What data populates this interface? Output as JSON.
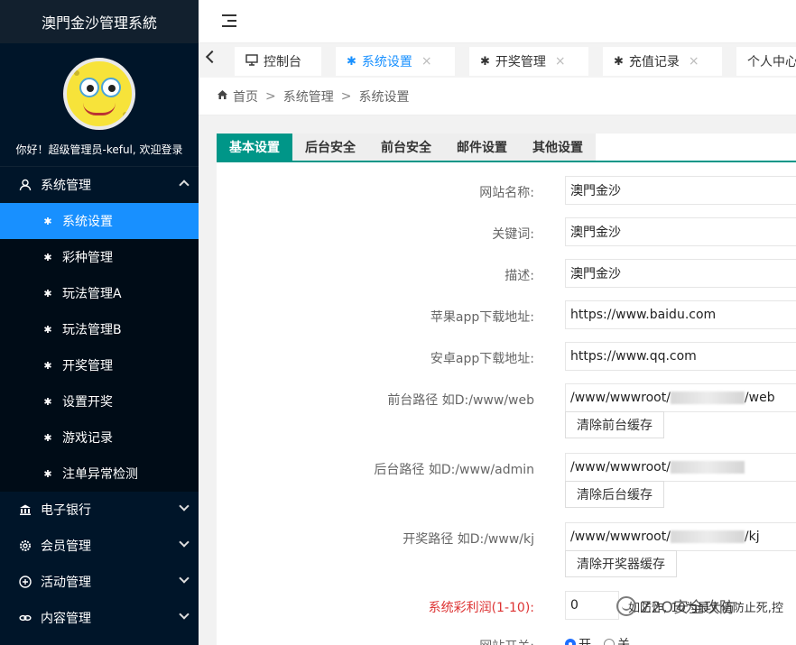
{
  "brand": {
    "title": "澳門金沙管理系統"
  },
  "user": {
    "welcome": "你好！超级管理员-keful, 欢迎登录"
  },
  "sidebar": {
    "groups": [
      {
        "label": "系统管理",
        "icon": "user-icon",
        "expanded": true
      },
      {
        "label": "电子银行",
        "icon": "bank-icon"
      },
      {
        "label": "会员管理",
        "icon": "gear-icon"
      },
      {
        "label": "活动管理",
        "icon": "plus-circle-icon"
      },
      {
        "label": "内容管理",
        "icon": "link-icon"
      }
    ],
    "items": [
      {
        "label": "系统设置",
        "active": true
      },
      {
        "label": "彩种管理"
      },
      {
        "label": "玩法管理A"
      },
      {
        "label": "玩法管理B"
      },
      {
        "label": "开奖管理"
      },
      {
        "label": "设置开奖"
      },
      {
        "label": "游戏记录"
      },
      {
        "label": "注单异常检测"
      }
    ]
  },
  "tabs": [
    {
      "label": "控制台",
      "icon": "monitor-icon"
    },
    {
      "label": "系统设置",
      "icon": "palm-icon",
      "active": true,
      "close": "×"
    },
    {
      "label": "开奖管理",
      "icon": "palm-icon",
      "close": "×"
    },
    {
      "label": "充值记录",
      "icon": "palm-icon",
      "close": "×"
    },
    {
      "label": "个人中心"
    }
  ],
  "breadcrumb": {
    "home": "首页",
    "sep": ">",
    "level1": "系统管理",
    "level2": "系统设置"
  },
  "subtabs": [
    "基本设置",
    "后台安全",
    "前台安全",
    "邮件设置",
    "其他设置"
  ],
  "form": {
    "site_name_label": "网站名称:",
    "site_name": "澳門金沙",
    "keywords_label": "关键词:",
    "keywords": "澳門金沙",
    "description_label": "描述:",
    "description": "澳門金沙",
    "ios_label": "苹果app下载地址:",
    "ios_url": "https://www.baidu.com",
    "android_label": "安卓app下载地址:",
    "android_url": "https://www.qq.com",
    "front_label": "前台路径 如D:/www/web",
    "front_prefix": "/www/wwwroot/",
    "front_suffix": "/web",
    "front_btn": "清除前台缓存",
    "admin_label": "后台路径 如D:/www/admin",
    "admin_prefix": "/www/wwwroot/",
    "admin_btn": "清除后台缓存",
    "kj_label": "开奖路径 如D:/www/kj",
    "kj_prefix": "/www/wwwroot/",
    "kj_suffix": "/kj",
    "kj_btn": "清除开奖器缓存",
    "profit_label": "系统彩利润(1-10):",
    "profit_value": "0",
    "profit_hint": "如防炸, 10为最大值防止死,控",
    "switch_label": "网站开关:",
    "switch_on": "开",
    "switch_off": "关"
  },
  "watermark": {
    "text": "Z2O安全攻防"
  }
}
